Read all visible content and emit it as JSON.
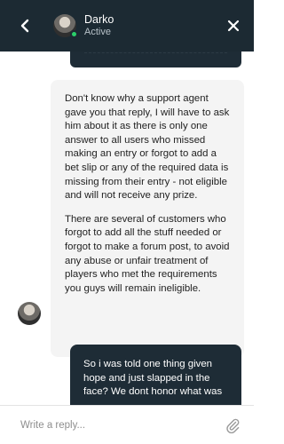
{
  "header": {
    "agent_name": "Darko",
    "agent_status": "Active",
    "back_icon": "chevron-left-icon",
    "close_icon": "close-icon",
    "status_color": "#2bd06a",
    "background": "#1c2a33"
  },
  "messages": {
    "agent_message": {
      "paragraphs": [
        "Don't know why a support agent gave you that reply, I will have to ask him about it as there is only one answer to all users who missed making an entry or forgot to add a bet slip or any of the required data is missing from their entry - not eligible and will not receive any prize.",
        "There are several of customers who forgot to add all the stuff needed or forgot to make a forum post, to avoid any abuse or unfair treatment of players who met the requirements you guys will remain ineligible."
      ]
    },
    "user_message": {
      "text": "So i was told one thing given hope and just slapped in the face? We dont honor what was"
    }
  },
  "composer": {
    "placeholder": "Write a reply...",
    "attach_icon": "paperclip-icon"
  }
}
